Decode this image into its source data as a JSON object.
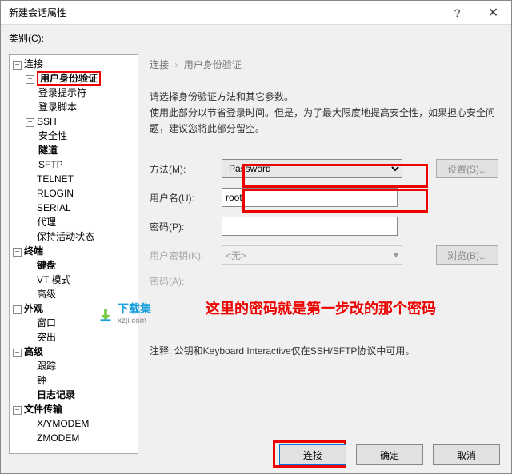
{
  "window": {
    "title": "新建会话属性"
  },
  "category_label": "类别(C):",
  "tree": {
    "connection": "连接",
    "auth": "用户身份验证",
    "login_prompt": "登录提示符",
    "login_script": "登录脚本",
    "ssh": "SSH",
    "security": "安全性",
    "tunnel": "隧道",
    "sftp": "SFTP",
    "telnet": "TELNET",
    "rlogin": "RLOGIN",
    "serial": "SERIAL",
    "proxy": "代理",
    "keepalive": "保持活动状态",
    "terminal": "终端",
    "keyboard": "键盘",
    "vt": "VT 模式",
    "adv1": "高级",
    "appearance": "外观",
    "window2": "窗口",
    "highlight2": "突出",
    "advanced": "高级",
    "trace": "跟踪",
    "bell": "钟",
    "log": "日志记录",
    "filetransfer": "文件传输",
    "xymodem": "X/YMODEM",
    "zmodem": "ZMODEM"
  },
  "breadcrumb": {
    "a": "连接",
    "b": "用户身份验证"
  },
  "desc": {
    "line1": "请选择身份验证方法和其它参数。",
    "line2": "使用此部分以节省登录时间。但是，为了最大限度地提高安全性，如果担心安全问题，建议您将此部分留空。"
  },
  "form": {
    "method_label": "方法(M):",
    "method_value": "Password",
    "setup_btn": "设置(S)...",
    "user_label": "用户名(U):",
    "user_value": "root",
    "pass_label": "密码(P):",
    "pass_value": "",
    "userkey_label": "用户密钥(K):",
    "userkey_value": "<无>",
    "browse_btn": "浏览(B)...",
    "passphrase_label": "密码(A):"
  },
  "red_note": "这里的密码就是第一步改的那个密码",
  "note": "注释: 公钥和Keyboard Interactive仅在SSH/SFTP协议中可用。",
  "watermark": {
    "name": "下载集",
    "url": "xzji.com"
  },
  "footer": {
    "connect": "连接",
    "ok": "确定",
    "cancel": "取消"
  }
}
